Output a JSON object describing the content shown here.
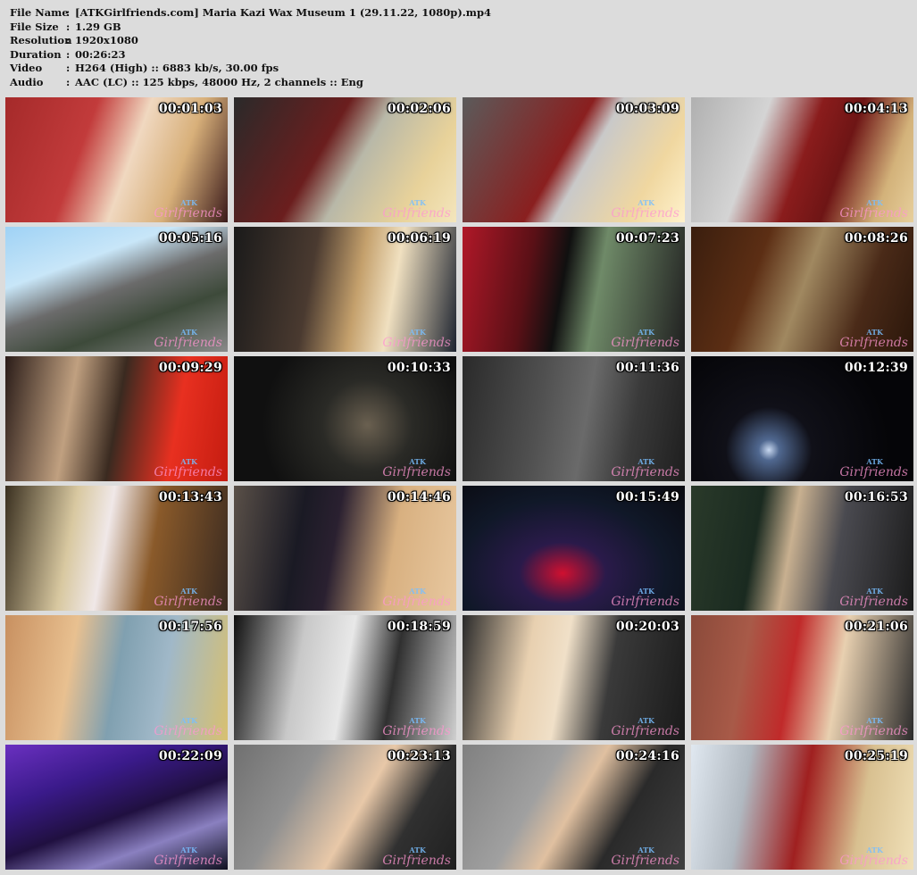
{
  "file_info": [
    {
      "key": "File Name",
      "value": "[ATKGirlfriends.com] Maria Kazi Wax Museum 1 (29.11.22, 1080p).mp4"
    },
    {
      "key": "File Size",
      "value": "1.29 GB"
    },
    {
      "key": "Resolution",
      "value": "1920x1080"
    },
    {
      "key": "Duration",
      "value": "00:26:23"
    },
    {
      "key": "Video",
      "value": "H264 (High) :: 6883 kb/s, 30.00 fps"
    },
    {
      "key": "Audio",
      "value": "AAC (LC) :: 125 kbps, 48000 Hz, 2 channels :: Eng"
    }
  ],
  "separator": ":",
  "watermark_top": "ATK",
  "watermark_bottom": "Girlfriends",
  "thumbnails": [
    {
      "time": "00:01:03",
      "bg": "linear-gradient(110deg,#a52a2a 0%,#c23b3b 35%,#f0d8c0 55%,#d8b07a 75%,#3a1a1a 100%)"
    },
    {
      "time": "00:02:06",
      "bg": "linear-gradient(120deg,#2a2a2a 0%,#6b1e1e 40%,#b8b8a8 55%,#e8d29a 80%,#f4e6bd 100%)"
    },
    {
      "time": "00:03:09",
      "bg": "linear-gradient(120deg,#5b5b5b 0%,#8a1f1f 45%,#c9c9c9 55%,#f0d7a0 80%,#fff2cc 100%)"
    },
    {
      "time": "00:04:13",
      "bg": "linear-gradient(110deg,#b0b0b0 0%,#d4d4d4 30%,#8a1c1c 50%,#6e1515 65%,#d3b27a 85%,#e7cf9c 100%)"
    },
    {
      "time": "00:05:16",
      "bg": "linear-gradient(160deg,#9fd2f5 0%,#c8e6f8 30%,#6b6b6b 50%,#3d4a3a 70%,#8a8a8a 100%)"
    },
    {
      "time": "00:06:19",
      "bg": "linear-gradient(100deg,#1a1a1a 0%,#4a3a30 35%,#c4a06c 55%,#f0e0c0 70%,#1e2430 100%)"
    },
    {
      "time": "00:07:23",
      "bg": "linear-gradient(100deg,#b01828 0%,#5a1016 30%,#101010 45%,#6f8a68 60%,#202020 100%)"
    },
    {
      "time": "00:08:26",
      "bg": "linear-gradient(110deg,#3a1e0e 0%,#5c2e14 30%,#a08860 50%,#4a2a18 75%,#2a160a 100%)"
    },
    {
      "time": "00:09:29",
      "bg": "linear-gradient(100deg,#2a1c18 0%,#c0a080 30%,#3a2a20 50%,#e83020 75%,#c41c10 100%)"
    },
    {
      "time": "00:10:33",
      "bg": "radial-gradient(circle at 60% 55%,#6a6050 0%,#2a2a26 30%,#101010 70%)"
    },
    {
      "time": "00:11:36",
      "bg": "linear-gradient(100deg,#2a2a2a 0%,#505050 35%,#6a6a6a 55%,#3a3a3a 75%,#1e1e1e 100%)"
    },
    {
      "time": "00:12:39",
      "bg": "radial-gradient(circle at 35% 75%,#c8d8f0 0%,#506890 6%,#101018 25%,#050508 70%)"
    },
    {
      "time": "00:13:43",
      "bg": "linear-gradient(100deg,#3a3020 0%,#d8c8a0 30%,#f0e8e8 45%,#8a5a2a 65%,#3a2a20 100%)"
    },
    {
      "time": "00:14:46",
      "bg": "linear-gradient(100deg,#5a5048 0%,#1a1a24 30%,#2a2030 45%,#d8b080 70%,#e8c8a0 100%)"
    },
    {
      "time": "00:15:49",
      "bg": "radial-gradient(ellipse at 45% 70%,#d01030 0%,#2a1a4a 25%,#101828 60%,#0a0a10 100%)"
    },
    {
      "time": "00:16:53",
      "bg": "linear-gradient(100deg,#2a3a2a 0%,#1a2a20 30%,#c8b090 45%,#4a4a50 65%,#1a1a1a 100%)"
    },
    {
      "time": "00:17:56",
      "bg": "linear-gradient(100deg,#c89060 0%,#e8c090 30%,#80a0b0 50%,#a0b8c8 70%,#d8c070 100%)"
    },
    {
      "time": "00:18:59",
      "bg": "linear-gradient(100deg,#101010 0%,#c8c8c8 30%,#e8e8e8 50%,#303030 70%,#d0d0d0 100%)"
    },
    {
      "time": "00:20:03",
      "bg": "linear-gradient(100deg,#2a2a2a 0%,#e8d0b0 30%,#f0e0c8 45%,#3a3a3a 65%,#1a1a1a 100%)"
    },
    {
      "time": "00:21:06",
      "bg": "linear-gradient(100deg,#8a4a3a 0%,#a85a48 25%,#c02a2a 45%,#e8d0b0 65%,#2a2a2a 100%)"
    },
    {
      "time": "00:22:09",
      "bg": "linear-gradient(160deg,#6a30c0 0%,#3a1a8a 30%,#201040 55%,#8a80c0 75%,#101020 100%)"
    },
    {
      "time": "00:23:13",
      "bg": "linear-gradient(120deg,#707070 0%,#909090 30%,#e8c8a8 55%,#303030 75%,#202020 100%)"
    },
    {
      "time": "00:24:16",
      "bg": "linear-gradient(120deg,#808080 0%,#a0a0a0 35%,#e0c0a0 50%,#2a2a2a 70%,#404040 100%)"
    },
    {
      "time": "00:25:19",
      "bg": "linear-gradient(100deg,#e0e8f0 0%,#b0b8c0 25%,#a02020 50%,#d8c090 75%,#f0e0b8 100%)"
    }
  ]
}
